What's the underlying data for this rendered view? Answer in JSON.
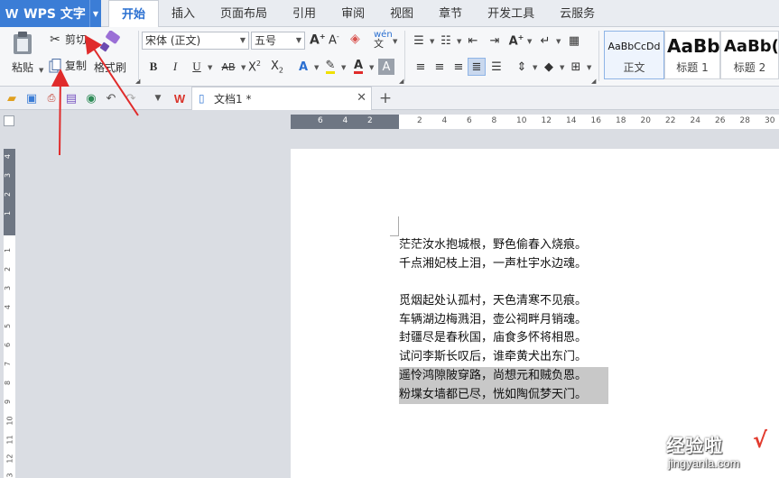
{
  "app": {
    "name": "WPS 文字",
    "logo": "W"
  },
  "tabs": [
    "开始",
    "插入",
    "页面布局",
    "引用",
    "审阅",
    "视图",
    "章节",
    "开发工具",
    "云服务"
  ],
  "ribbon": {
    "paste": "粘贴",
    "cut": "剪切",
    "copy": "复制",
    "format_painter": "格式刷",
    "font_name": "宋体 (正文)",
    "font_size": "五号",
    "styles": [
      {
        "sample": "AaBbCcDd",
        "label": "正文"
      },
      {
        "sample": "AaBb",
        "label": "标题 1"
      },
      {
        "sample": "AaBb(",
        "label": "标题 2"
      }
    ]
  },
  "doc_tab": {
    "name": "文档1 *"
  },
  "ruler": {
    "h_ticks": [
      "6",
      "4",
      "2",
      "",
      "2",
      "4",
      "6",
      "8",
      "10",
      "12",
      "14",
      "16",
      "18",
      "20",
      "22",
      "24",
      "26",
      "28",
      "30"
    ],
    "v_ticks_top": [
      "4",
      "3",
      "2",
      "1"
    ],
    "v_ticks_body": [
      "1",
      "2",
      "3",
      "4",
      "5",
      "6",
      "7",
      "8",
      "9",
      "10",
      "11",
      "12",
      "13"
    ]
  },
  "document": {
    "lines": [
      {
        "text": "茫茫汝水抱城根，野色偷春入烧痕。",
        "highlight": false
      },
      {
        "text": "千点湘妃枝上泪，一声杜宇水边魂。",
        "highlight": false
      },
      {
        "text": "",
        "highlight": false
      },
      {
        "text": "觅烟起处认孤村，天色清寒不见痕。",
        "highlight": false
      },
      {
        "text": "车辆湖边梅溅泪，壶公祠畔月销魂。",
        "highlight": false
      },
      {
        "text": "封疆尽是春秋国，庙食多怀将相恩。",
        "highlight": false
      },
      {
        "text": "试问李斯长叹后，谁牵黄犬出东门。",
        "highlight": false
      },
      {
        "text": "遥怜鸿隙陂穿路，尚想元和贼负恩。",
        "highlight": true
      },
      {
        "text": "粉堞女墙都已尽，恍如陶侃梦天门。",
        "highlight": true
      }
    ]
  },
  "watermark": {
    "line1": "经验啦",
    "line2": "jingyanla.com",
    "check": "√"
  },
  "colors": {
    "app_blue": "#3b7dd6",
    "active_tab_text": "#2a6fd1",
    "annotation_red": "#e02b2b",
    "selection_gray": "#c8c8c8"
  }
}
